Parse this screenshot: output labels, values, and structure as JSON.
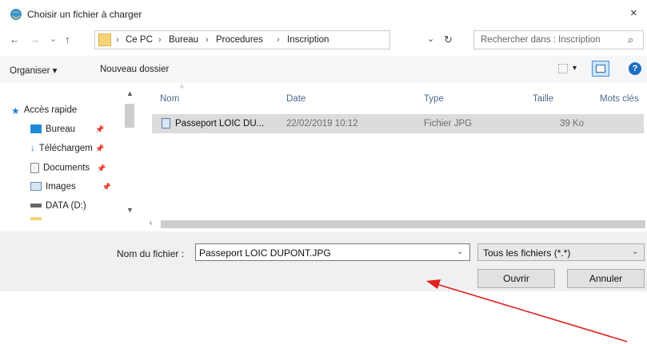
{
  "window": {
    "title": "Choisir un fichier à charger",
    "close_glyph": "×",
    "icon": "browser-globe-icon"
  },
  "address_bar": {
    "back_glyph": "←",
    "forward_glyph": "→",
    "recent_glyph": "⌄",
    "up_glyph": "↑",
    "breadcrumbs": [
      "Ce PC",
      "Bureau",
      "Procedures",
      "Inscription"
    ],
    "separator": "›",
    "dropdown_glyph": "⌄",
    "refresh_glyph": "↻",
    "search_placeholder": "Rechercher dans : Inscription",
    "search_icon": "⌕"
  },
  "toolbar": {
    "organize_label": "Organiser ▾",
    "new_folder_label": "Nouveau dossier",
    "view_glyph": "▾",
    "help_glyph": "?"
  },
  "sidebar": {
    "items": [
      {
        "label": "Accès rapide",
        "icon": "star-icon"
      },
      {
        "label": "Bureau",
        "icon": "desktop-icon",
        "pin": "📌"
      },
      {
        "label": "Téléchargem",
        "icon": "download-icon",
        "pin": "📌"
      },
      {
        "label": "Documents",
        "icon": "documents-icon",
        "pin": "📌"
      },
      {
        "label": "Images",
        "icon": "pictures-icon",
        "pin": "📌"
      },
      {
        "label": "DATA (D:)",
        "icon": "drive-icon"
      }
    ]
  },
  "file_list": {
    "columns": [
      "Nom",
      "Date",
      "Type",
      "Taille",
      "Mots clés"
    ],
    "rows": [
      {
        "name": "Passeport LOIC DU...",
        "date": "22/02/2019 10:12",
        "type": "Fichier JPG",
        "size": "39 Ko"
      }
    ]
  },
  "footer": {
    "filename_label": "Nom du fichier :",
    "filename_value": "Passeport LOIC DUPONT.JPG",
    "filetype_value": "Tous les fichiers (*.*)",
    "open_label": "Ouvrir",
    "cancel_label": "Annuler"
  },
  "colors": {
    "arrow": "#e02020",
    "column_header": "#4d6a8c",
    "selected_row": "#dcdcdc"
  }
}
